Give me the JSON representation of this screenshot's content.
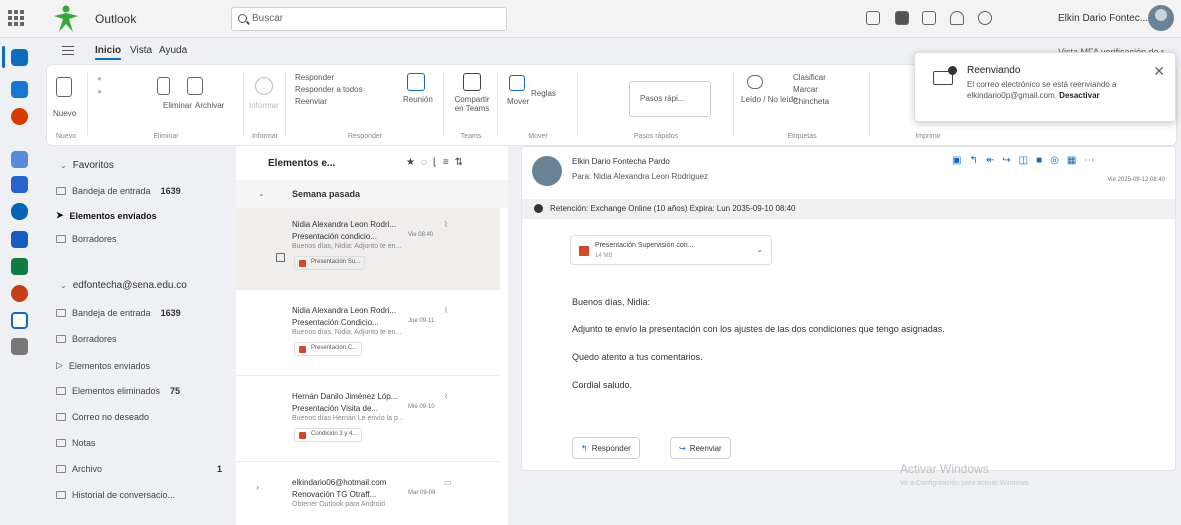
{
  "header": {
    "app": "Outlook",
    "search_placeholder": "Buscar",
    "user": "Elkin Dario Fontec..."
  },
  "tabs": {
    "inicio": "Inicio",
    "vista": "Vista",
    "ayuda": "Ayuda",
    "verification": "Vista MFA verificación de r..."
  },
  "ribbon": {
    "nuevo": "Nuevo",
    "nuevo_group": "Nuevo",
    "eliminar": "Eliminar",
    "archivar": "Archivar",
    "eliminar_group": "Eliminar",
    "informar": "Informar",
    "informar_group": "Informar",
    "responder": "Responder",
    "responder_todos": "Responder a todos",
    "reenviar": "Reenviar",
    "reunion": "Reunión",
    "responder_group": "Responder",
    "compartir": "Compartir en Teams",
    "teams_group": "Teams",
    "mover": "Mover",
    "reglas": "Reglas",
    "mover_group": "Mover",
    "pasos": "Pasos rápi...",
    "pasos_group": "Pasos rápidos",
    "leido": "Leído / No leído",
    "clasificar": "Clasificar",
    "marcar": "Marcar",
    "chincheta": "Chincheta",
    "etiquetas_group": "Etiquetas",
    "imprimir_group": "Imprimir"
  },
  "toast": {
    "title": "Reenviando",
    "body": "El correo electrónico se está reenviando a elkindario0p@gmail.com.",
    "action": "Desactivar"
  },
  "folders": {
    "favoritos": "Favoritos",
    "fav_inbox": "Bandeja de entrada",
    "fav_inbox_count": "1639",
    "fav_sent": "Elementos enviados",
    "fav_drafts": "Borradores",
    "account": "edfontecha@sena.edu.co",
    "inbox": "Bandeja de entrada",
    "inbox_count": "1639",
    "drafts": "Borradores",
    "sent": "Elementos enviados",
    "deleted": "Elementos eliminados",
    "deleted_count": "75",
    "junk": "Correo no deseado",
    "notes": "Notas",
    "archive": "Archivo",
    "archive_count": "1",
    "history": "Historial de conversacio..."
  },
  "list": {
    "title": "Elementos e...",
    "group": "Semana pasada",
    "items": [
      {
        "sender": "Nidia Alexandra Leon Rodri...",
        "subject": "Presentación condicio...",
        "date": "Vie 08:40",
        "preview": "Buenos días, Nidia: Adjunto te en...",
        "att": "Presentación Su..."
      },
      {
        "sender": "Nidia Alexandra Leon Rodri...",
        "subject": "Presentación Condicio...",
        "date": "Jue 09-11",
        "preview": "Buenos días, Nidia: Adjunto te en...",
        "att": "Presentación C..."
      },
      {
        "sender": "Hernán Danilo Jiménez Lóp...",
        "subject": "Presentación Visita de...",
        "date": "Mié 09-10",
        "preview": "Buenos días Hernán Le envío la p...",
        "att": "Condición 3 y 4..."
      },
      {
        "sender": "elkindario06@hotmail.com",
        "subject": "Renovación TG Otraff...",
        "date": "Mar 09-09",
        "preview": "Obtener Outlook para Android"
      }
    ]
  },
  "reading": {
    "from": "Elkin Dario Fontecha Pardo",
    "to": "Para: Nidia Alexandra Leon Rodriguez",
    "date": "Vie 2025-09-12 08:40",
    "retention": "Retención: Exchange Online (10 años) Expira: Lun 2035-09-10 08:40",
    "att_name": "Presentación Supervisión con...",
    "att_size": "14 MB",
    "line1": "Buenos días, Nidia:",
    "line2": "Adjunto te envío la presentación con los ajustes de las dos condiciones que tengo asignadas.",
    "line3": "Quedo atento a tus comentarios.",
    "line4": "Cordial saludo.",
    "reply": "Responder",
    "forward": "Reenviar"
  },
  "watermark": {
    "title": "Activar Windows",
    "sub": "Ve a Configuración para activar Windows."
  }
}
